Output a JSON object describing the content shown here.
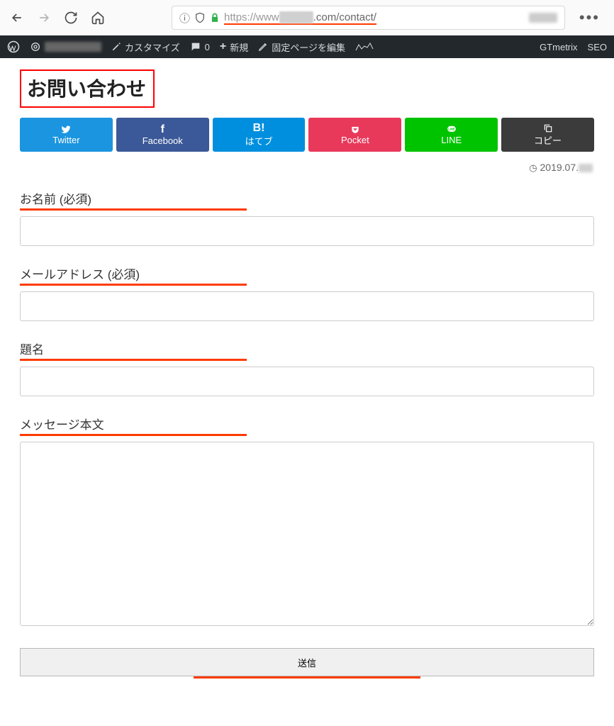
{
  "browser": {
    "url_proto": "https://www",
    "url_suffix": ".com/contact/"
  },
  "wpbar": {
    "customize": "カスタマイズ",
    "comments": "0",
    "new": "新規",
    "edit": "固定ページを編集",
    "gtmetrix": "GTmetrix",
    "seo": "SEO"
  },
  "page": {
    "title": "お問い合わせ",
    "date_prefix": "2019.07."
  },
  "share": {
    "twitter": "Twitter",
    "facebook": "Facebook",
    "hatena": "はてブ",
    "hatena_icon": "B!",
    "pocket": "Pocket",
    "line": "LINE",
    "copy": "コピー"
  },
  "form": {
    "name_label": "お名前 (必須)",
    "email_label": "メールアドレス (必須)",
    "subject_label": "題名",
    "message_label": "メッセージ本文",
    "submit": "送信"
  }
}
